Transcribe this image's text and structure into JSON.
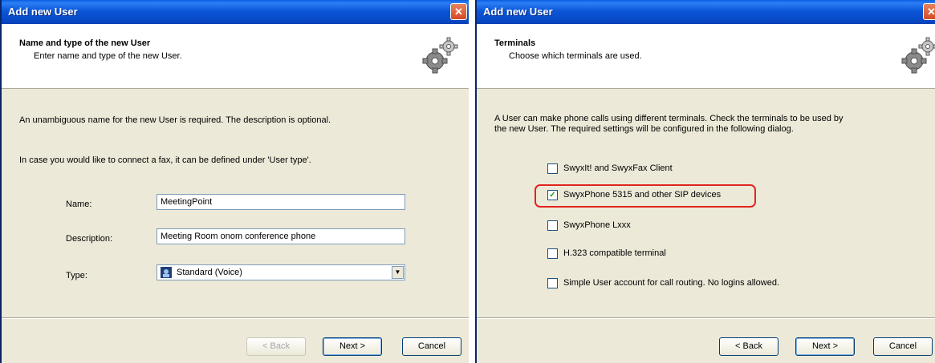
{
  "left_dialog": {
    "title": "Add new User",
    "header_title": "Name and type of the new User",
    "header_subtitle": "Enter name and type of the new User.",
    "intro": "An unambiguous name for the new User is required. The description is optional.",
    "fax_note": "In case you would like to connect a fax, it can be defined under 'User type'.",
    "name_label": "Name:",
    "name_value": "MeetingPoint",
    "description_label": "Description:",
    "description_value": "Meeting Room onom conference phone",
    "type_label": "Type:",
    "type_value": "Standard (Voice)",
    "back_label": "< Back",
    "next_label": "Next >",
    "cancel_label": "Cancel"
  },
  "right_dialog": {
    "title": "Add new User",
    "header_title": "Terminals",
    "header_subtitle": "Choose which terminals are used.",
    "intro_line1": "A User can make phone calls using different terminals. Check the terminals to be used by",
    "intro_line2": "the new User. The required settings will be configured in the following dialog.",
    "terminals": [
      {
        "label": "SwyxIt! and SwyxFax Client",
        "checked": false
      },
      {
        "label": "SwyxPhone 5315 and other SIP devices",
        "checked": true
      },
      {
        "label": "SwyxPhone Lxxx",
        "checked": false
      },
      {
        "label": "H.323 compatible terminal",
        "checked": false
      },
      {
        "label": "Simple User account for call routing. No logins allowed.",
        "checked": false
      }
    ],
    "back_label": "< Back",
    "next_label": "Next >",
    "cancel_label": "Cancel"
  },
  "icons": {
    "close": "close-icon",
    "gear": "gear-icon",
    "voice": "voice-type-icon",
    "dropdown": "chevron-down-icon",
    "check": "checkmark-icon"
  }
}
